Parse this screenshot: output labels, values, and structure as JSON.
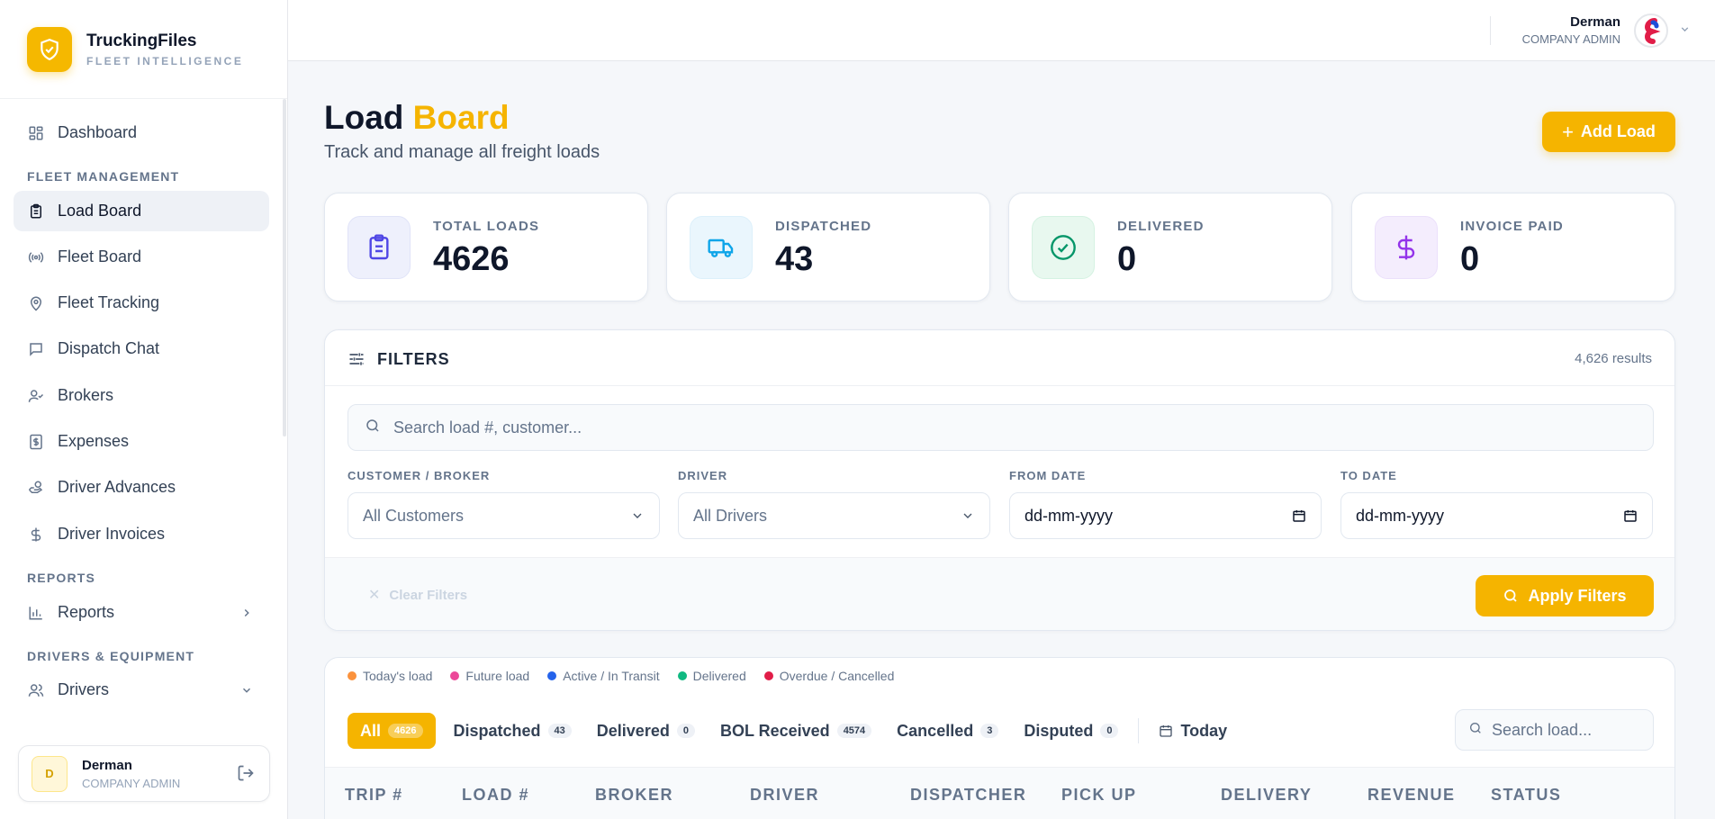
{
  "brand": {
    "name": "TruckingFiles",
    "subtitle": "FLEET INTELLIGENCE"
  },
  "sidebar": {
    "dashboard": "Dashboard",
    "section_fleet": "FLEET MANAGEMENT",
    "items": [
      {
        "label": "Load Board",
        "icon": "clipboard-icon",
        "active": true
      },
      {
        "label": "Fleet Board",
        "icon": "broadcast-icon"
      },
      {
        "label": "Fleet Tracking",
        "icon": "map-pin-icon"
      },
      {
        "label": "Dispatch Chat",
        "icon": "chat-icon"
      },
      {
        "label": "Brokers",
        "icon": "user-check-icon"
      },
      {
        "label": "Expenses",
        "icon": "receipt-icon"
      },
      {
        "label": "Driver Advances",
        "icon": "hand-coins-icon"
      },
      {
        "label": "Driver Invoices",
        "icon": "dollar-icon"
      }
    ],
    "section_reports": "REPORTS",
    "reports": "Reports",
    "section_drivers": "DRIVERS & EQUIPMENT",
    "drivers": "Drivers"
  },
  "user": {
    "initial": "D",
    "name": "Derman",
    "role": "COMPANY ADMIN"
  },
  "page": {
    "title_main": "Load",
    "title_accent": "Board",
    "subtitle": "Track and manage all freight loads",
    "add_button": "Add Load"
  },
  "stats": [
    {
      "label": "TOTAL LOADS",
      "value": "4626",
      "icon": "clipboard-list-icon",
      "color": "#4f46e5"
    },
    {
      "label": "DISPATCHED",
      "value": "43",
      "icon": "truck-icon",
      "color": "#0ea5e9"
    },
    {
      "label": "DELIVERED",
      "value": "0",
      "icon": "check-circle-icon",
      "color": "#059669"
    },
    {
      "label": "INVOICE PAID",
      "value": "0",
      "icon": "dollar-icon",
      "color": "#9333ea"
    }
  ],
  "filters": {
    "title": "FILTERS",
    "results": "4,626 results",
    "search_placeholder": "Search load #, customer...",
    "customer_label": "CUSTOMER / BROKER",
    "customer_value": "All Customers",
    "driver_label": "DRIVER",
    "driver_value": "All Drivers",
    "from_label": "FROM DATE",
    "from_value": "dd-mm-yyyy",
    "to_label": "TO DATE",
    "to_value": "dd-mm-yyyy",
    "clear": "Clear Filters",
    "apply": "Apply Filters"
  },
  "legend": [
    {
      "label": "Today's load",
      "color": "#fb923c"
    },
    {
      "label": "Future load",
      "color": "#ec4899"
    },
    {
      "label": "Active / In Transit",
      "color": "#2563eb"
    },
    {
      "label": "Delivered",
      "color": "#10b981"
    },
    {
      "label": "Overdue / Cancelled",
      "color": "#e11d48"
    }
  ],
  "tabs": [
    {
      "label": "All",
      "count": "4626"
    },
    {
      "label": "Dispatched",
      "count": "43"
    },
    {
      "label": "Delivered",
      "count": "0"
    },
    {
      "label": "BOL Received",
      "count": "4574"
    },
    {
      "label": "Cancelled",
      "count": "3"
    },
    {
      "label": "Disputed",
      "count": "0"
    }
  ],
  "today_tab": "Today",
  "list_search_placeholder": "Search load...",
  "columns": [
    "TRIP #",
    "LOAD #",
    "BROKER",
    "DRIVER",
    "DISPATCHER",
    "PICK UP",
    "DELIVERY",
    "REVENUE",
    "STATUS"
  ]
}
